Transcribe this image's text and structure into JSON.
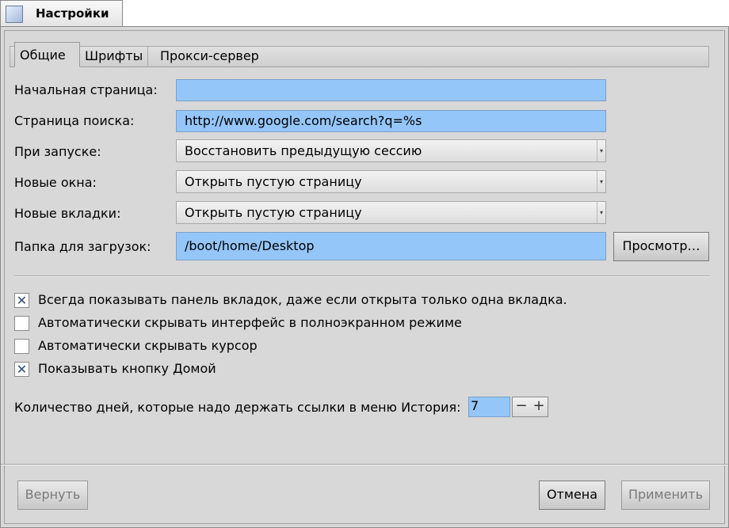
{
  "window": {
    "title": "Настройки"
  },
  "tabs": [
    {
      "label": "Общие",
      "active": true
    },
    {
      "label": "Шрифты",
      "active": false
    },
    {
      "label": "Прокси-сервер",
      "active": false
    }
  ],
  "general": {
    "start_page": {
      "label": "Начальная страница:",
      "value": ""
    },
    "search_page": {
      "label": "Страница поиска:",
      "value": "http://www.google.com/search?q=%s"
    },
    "on_startup": {
      "label": "При запуске:",
      "value": "Восстановить предыдущую сессию"
    },
    "new_windows": {
      "label": "Новые окна:",
      "value": "Открыть пустую страницу"
    },
    "new_tabs": {
      "label": "Новые вкладки:",
      "value": "Открыть пустую страницу"
    },
    "download_folder": {
      "label": "Папка для загрузок:",
      "value": "/boot/home/Desktop",
      "browse_label": "Просмотр…"
    }
  },
  "checkboxes": [
    {
      "label": "Всегда показывать панель вкладок, даже если открыта только одна вкладка.",
      "checked": true
    },
    {
      "label": "Автоматически скрывать интерфейс в полноэкранном режиме",
      "checked": false
    },
    {
      "label": "Автоматически скрывать курсор",
      "checked": false
    },
    {
      "label": "Показывать кнопку Домой",
      "checked": true
    }
  ],
  "history": {
    "label": "Количество дней, которые надо держать ссылки в меню История:",
    "value": "7",
    "minus": "−",
    "plus": "+"
  },
  "buttons": {
    "revert": "Вернуть",
    "cancel": "Отмена",
    "apply": "Применить"
  },
  "colors": {
    "input_bg": "#95c6f9",
    "window_bg": "#d8d8d8",
    "check_mark": "#2e4b72"
  },
  "icons": {
    "check": "✕",
    "dropdown": "▾"
  }
}
